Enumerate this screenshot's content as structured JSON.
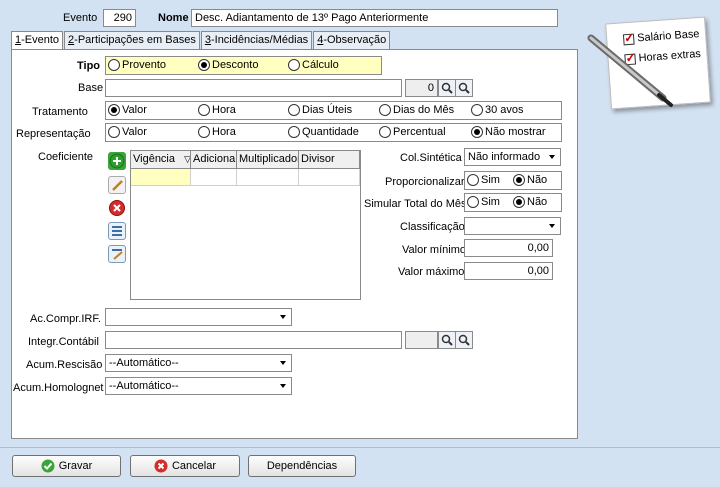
{
  "header": {
    "evento_label": "Evento",
    "evento_value": "290",
    "nome_label": "Nome",
    "nome_value": "Desc.  Adiantamento de 13º Pago Anteriormente"
  },
  "tabs": [
    {
      "key": "1",
      "label": "-Evento"
    },
    {
      "key": "2",
      "label": "-Participações em Bases"
    },
    {
      "key": "3",
      "label": "-Incidências/Médias"
    },
    {
      "key": "4",
      "label": "-Observação"
    }
  ],
  "tipo": {
    "label": "Tipo",
    "options": [
      "Provento",
      "Desconto",
      "Cálculo"
    ],
    "selected": 1
  },
  "base": {
    "label": "Base",
    "value": "",
    "code": "0"
  },
  "tratamento": {
    "label": "Tratamento",
    "options": [
      "Valor",
      "Hora",
      "Dias Úteis",
      "Dias do Mês",
      "30 avos"
    ],
    "selected": 0
  },
  "representacao": {
    "label": "Representação",
    "options": [
      "Valor",
      "Hora",
      "Quantidade",
      "Percentual",
      "Não mostrar"
    ],
    "selected": 4
  },
  "coeficiente": {
    "label": "Coeficiente",
    "columns": [
      "Vigência",
      "Adicional",
      "Multiplicador",
      "Divisor"
    ]
  },
  "right": {
    "col_sintetica": {
      "label": "Col.Sintética",
      "value": "Não informado"
    },
    "proporcionalizar": {
      "label": "Proporcionalizar",
      "options": [
        "Sim",
        "Não"
      ],
      "selected": 1
    },
    "simular": {
      "label": "Simular Total do Mês",
      "options": [
        "Sim",
        "Não"
      ],
      "selected": 1
    },
    "classificacao": {
      "label": "Classificação",
      "value": ""
    },
    "valor_minimo": {
      "label": "Valor mínimo",
      "value": "0,00"
    },
    "valor_maximo": {
      "label": "Valor máximo",
      "value": "0,00"
    }
  },
  "lower": {
    "ac_compr": {
      "label": "Ac.Compr.IRF.",
      "value": ""
    },
    "integr": {
      "label": "Integr.Contábil",
      "value": ""
    },
    "acum_rescisao": {
      "label": "Acum.Rescisão",
      "value": "--Automático--"
    },
    "acum_homolognet": {
      "label": "Acum.Homolognet",
      "value": "--Automático--"
    }
  },
  "note": {
    "items": [
      "Salário Base",
      "Horas extras"
    ]
  },
  "buttons": {
    "gravar": "Gravar",
    "cancelar": "Cancelar",
    "dependencias": "Dependências"
  },
  "colors": {
    "background": "#d3e2f2",
    "tipo_highlight": "#ffffc0"
  }
}
